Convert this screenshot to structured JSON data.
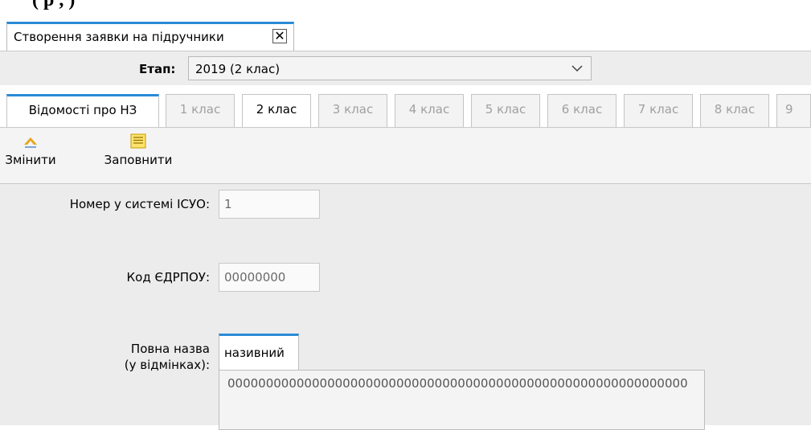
{
  "top_strip_text": "(                             р  ,                                  )",
  "doc_tab": {
    "label": "Створення заявки на підручники"
  },
  "stage": {
    "label": "Етап:",
    "value": "2019 (2 клас)"
  },
  "class_tabs": [
    {
      "label": "Відомості про НЗ"
    },
    {
      "label": "1 клас"
    },
    {
      "label": "2 клас"
    },
    {
      "label": "3 клас"
    },
    {
      "label": "4 клас"
    },
    {
      "label": "5 клас"
    },
    {
      "label": "6 клас"
    },
    {
      "label": "7 клас"
    },
    {
      "label": "8 клас"
    },
    {
      "label": "9"
    }
  ],
  "toolbar": {
    "edit_label": "Змінити",
    "fill_label": "Заповнити"
  },
  "form": {
    "isuo_label": "Номер у системі ІСУО:",
    "isuo_value": "1",
    "edrpou_label": "Код ЄДРПОУ:",
    "edrpou_value": "00000000",
    "full_name_label_1": "Повна назва",
    "full_name_label_2": "(у відмінках):",
    "case_tab": "називний",
    "full_name_value": "000000000000000000000000000000000000000000000000000000000000"
  },
  "colors": {
    "accent": "#2a8bd6",
    "panel_bg": "#ececec"
  }
}
